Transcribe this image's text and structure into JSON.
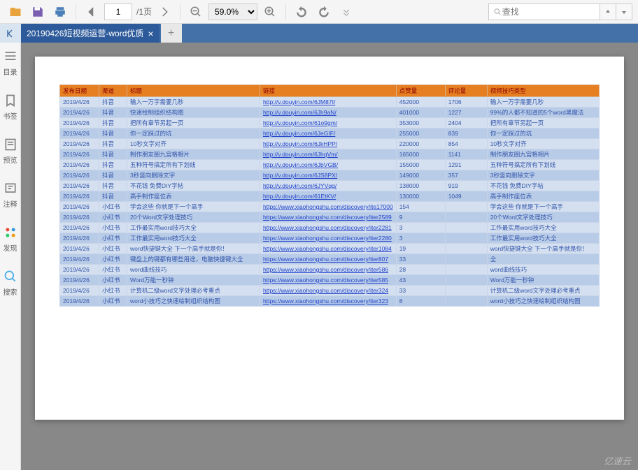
{
  "toolbar": {
    "page_current": "1",
    "page_total": "/1页",
    "zoom": "59.0%",
    "find_placeholder": "查找"
  },
  "tab": {
    "label": "20190426短视频运营-word优质",
    "close": "×",
    "add": "+"
  },
  "sidebar": {
    "items": [
      {
        "label": "目录"
      },
      {
        "label": "书签"
      },
      {
        "label": "预览"
      },
      {
        "label": "注释"
      },
      {
        "label": "发现"
      },
      {
        "label": "搜索"
      }
    ]
  },
  "table": {
    "headers": [
      "发布日期",
      "渠道",
      "标题",
      "链接",
      "点赞量",
      "评论量",
      "视频技巧类型"
    ],
    "rows": [
      {
        "date": "2019/4/26",
        "channel": "抖音",
        "title": "输入一万字需要几秒",
        "link": "http://v.douyin.com/6JM87I/",
        "likes": "452000",
        "comments": "1706",
        "type": "输入一万字需要几秒"
      },
      {
        "date": "2019/4/26",
        "channel": "抖音",
        "title": "快速绘制组织结构图",
        "link": "http://v.douyin.com/6Jh9aN/",
        "likes": "401000",
        "comments": "1227",
        "type": "99%的人都不知道的5个word黑魔法"
      },
      {
        "date": "2019/4/26",
        "channel": "抖音",
        "title": "把所有章节另起一页",
        "link": "http://v.douyin.com/61o9gm/",
        "likes": "353000",
        "comments": "2404",
        "type": "把所有章节另起一页"
      },
      {
        "date": "2019/4/26",
        "channel": "抖音",
        "title": "你一定踩过的坑",
        "link": "http://v.douyin.com/6JeGIF/",
        "likes": "255000",
        "comments": "839",
        "type": "你一定踩过的坑"
      },
      {
        "date": "2019/4/26",
        "channel": "抖音",
        "title": "10秒文字对齐",
        "link": "http://v.douyin.com/6JkHPP/",
        "likes": "220000",
        "comments": "854",
        "type": "10秒文字对齐"
      },
      {
        "date": "2019/4/26",
        "channel": "抖音",
        "title": "制作朋友圈九宫格相片",
        "link": "http://v.douyin.com/6JhqVm/",
        "likes": "165000",
        "comments": "1141",
        "type": "制作朋友圈九宫格相片"
      },
      {
        "date": "2019/4/26",
        "channel": "抖音",
        "title": "五种符号搞定所有下划线",
        "link": "http://v.douyin.com/6JbVGB/",
        "likes": "155000",
        "comments": "1291",
        "type": "五种符号搞定所有下划线"
      },
      {
        "date": "2019/4/26",
        "channel": "抖音",
        "title": "3秒竖向删除文字",
        "link": "http://v.douyin.com/6JS8PX/",
        "likes": "149000",
        "comments": "357",
        "type": "3秒竖向删除文字"
      },
      {
        "date": "2019/4/26",
        "channel": "抖音",
        "title": "不花钱 免费DIY字帖",
        "link": "http://v.douyin.com/6JYVqg/",
        "likes": "138000",
        "comments": "919",
        "type": "不花钱 免费DIY字帖"
      },
      {
        "date": "2019/4/26",
        "channel": "抖音",
        "title": "高手制作座位表",
        "link": "http://v.douyin.com/61EtKV/",
        "likes": "130000",
        "comments": "1049",
        "type": "高手制作座位表"
      },
      {
        "date": "2019/4/26",
        "channel": "小红书",
        "title": "学会这些 你就是下一个高手",
        "link": "https://www.xiaohongshu.com/discovery/ite17000",
        "likes": "154",
        "comments": "",
        "type": "学会这些 你就是下一个高手"
      },
      {
        "date": "2019/4/26",
        "channel": "小红书",
        "title": "20个Word文字处理技巧",
        "link": "https://www.xiaohongshu.com/discovery/iter2589",
        "likes": "9",
        "comments": "",
        "type": "20个Word文字处理技巧"
      },
      {
        "date": "2019/4/26",
        "channel": "小红书",
        "title": "工作最实用word技巧大全",
        "link": "https://www.xiaohongshu.com/discovery/iter2281",
        "likes": "3",
        "comments": "",
        "type": "工作最实用word技巧大全"
      },
      {
        "date": "2019/4/26",
        "channel": "小红书",
        "title": "工作最实用word技巧大全",
        "link": "https://www.xiaohongshu.com/discovery/iter2280",
        "likes": "3",
        "comments": "",
        "type": "工作最实用word技巧大全"
      },
      {
        "date": "2019/4/26",
        "channel": "小红书",
        "title": "word快捷键大全 下一个高手就是你！",
        "link": "https://www.xiaohongshu.com/discovery/iter1084",
        "likes": "19",
        "comments": "",
        "type": "word快捷键大全 下一个高手就是你！"
      },
      {
        "date": "2019/4/26",
        "channel": "小红书",
        "title": "键盘上的键都有哪些用途，电脑快捷键大全",
        "link": "https://www.xiaohongshu.com/discovery/iter807",
        "likes": "33",
        "comments": "",
        "type": "全"
      },
      {
        "date": "2019/4/26",
        "channel": "小红书",
        "title": "word曲线技巧",
        "link": "https://www.xiaohongshu.com/discovery/iter586",
        "likes": "28",
        "comments": "",
        "type": "word曲线技巧"
      },
      {
        "date": "2019/4/26",
        "channel": "小红书",
        "title": "Word万能一秒钟",
        "link": "https://www.xiaohongshu.com/discovery/iter585",
        "likes": "43",
        "comments": "",
        "type": "Word万能一秒钟"
      },
      {
        "date": "2019/4/26",
        "channel": "小红书",
        "title": "计算机二级word文字处理必考重点",
        "link": "https://www.xiaohongshu.com/discovery/iter324",
        "likes": "33",
        "comments": "",
        "type": "计算机二级word文字处理必考重点"
      },
      {
        "date": "2019/4/26",
        "channel": "小红书",
        "title": "word小技巧之快速绘制组织结构图",
        "link": "https://www.xiaohongshu.com/discovery/iter323",
        "likes": "8",
        "comments": "",
        "type": "word小技巧之快速绘制组织结构图"
      }
    ]
  },
  "watermark": "亿速云"
}
